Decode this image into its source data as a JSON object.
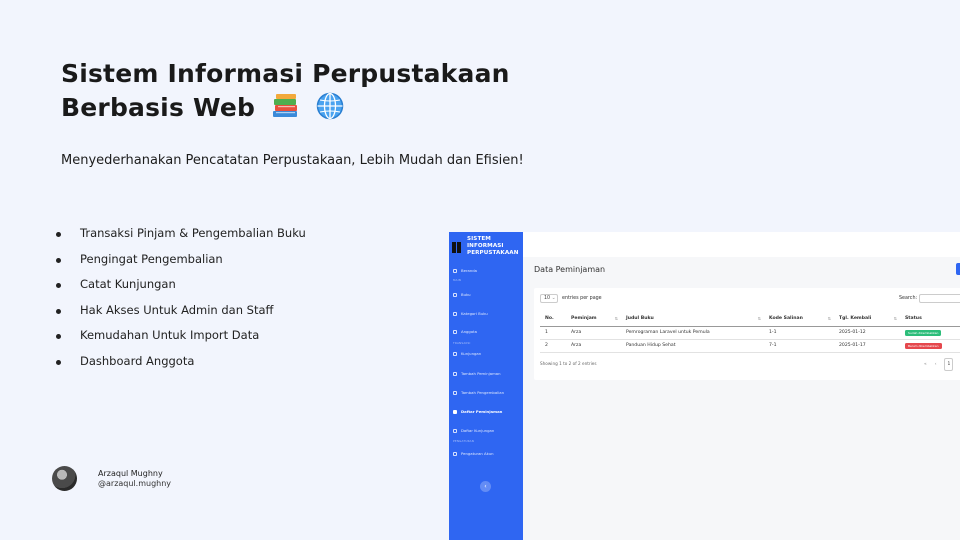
{
  "slide": {
    "title_line1": "Sistem Informasi Perpustakaan",
    "title_line2": "Berbasis Web",
    "title_icons": [
      "books-emoji",
      "globe-emoji"
    ],
    "subtitle": "Menyederhanakan Pencatatan Perpustakaan, Lebih Mudah dan Efisien!",
    "features": [
      "Transaksi Pinjam & Pengembalian Buku",
      "Pengingat Pengembalian",
      "Catat Kunjungan",
      "Hak Akses Untuk Admin dan Staff",
      "Kemudahan Untuk Import Data",
      "Dashboard Anggota"
    ],
    "author": {
      "name": "Arzaqul Mughny",
      "handle": "@arzaqul.mughny"
    }
  },
  "app": {
    "brand": {
      "line1": "SISTEM",
      "line2": "INFORMASI",
      "line3": "PERPUSTAKAAN"
    },
    "sidebar": {
      "items": [
        {
          "label": "Beranda",
          "icon": "home-icon"
        },
        {
          "label": "Buku",
          "icon": "book-icon"
        },
        {
          "label": "Kategori Buku",
          "icon": "folder-icon"
        },
        {
          "label": "Anggota",
          "icon": "user-icon"
        },
        {
          "label": "Kunjungan",
          "icon": "check-icon"
        },
        {
          "label": "Tambah Peminjaman",
          "icon": "arrow-icon"
        },
        {
          "label": "Tambah Pengembalian",
          "icon": "arrow-icon"
        },
        {
          "label": "Daftar Peminjaman",
          "icon": "list-icon",
          "active": true
        },
        {
          "label": "Daftar Kunjungan",
          "icon": "list-icon"
        },
        {
          "label": "Pengaturan Akun",
          "icon": "gear-icon"
        }
      ],
      "sections": [
        "MAIN",
        "TRANSAKSI",
        "PENGATURAN"
      ]
    },
    "page_title": "Data Peminjaman",
    "table": {
      "length_value": "10",
      "length_suffix": "entries per page",
      "search_label": "Search:",
      "columns": [
        "No.",
        "Peminjam",
        "Judul Buku",
        "Kode Salinan",
        "Tgl. Kembali",
        "Status"
      ],
      "rows": [
        {
          "no": "1",
          "peminjam": "Arza",
          "judul": "Pemrograman Laravel untuk Pemula",
          "kode": "1-1",
          "tgl": "2025-01-12",
          "status": "Sudah dikembalikan",
          "status_color": "#2dbd7a"
        },
        {
          "no": "2",
          "peminjam": "Arza",
          "judul": "Panduan Hidup Sehat",
          "kode": "7-1",
          "tgl": "2025-01-17",
          "status": "Belum dikembalikan",
          "status_color": "#e5484d"
        }
      ],
      "info": "Showing 1 to 2 of 2 entries",
      "pager": {
        "prev2": "«",
        "prev": "‹",
        "current": "1"
      }
    }
  },
  "colors": {
    "accent": "#2f66f2",
    "background": "#f2f5fd",
    "success": "#2dbd7a",
    "danger": "#e5484d"
  }
}
